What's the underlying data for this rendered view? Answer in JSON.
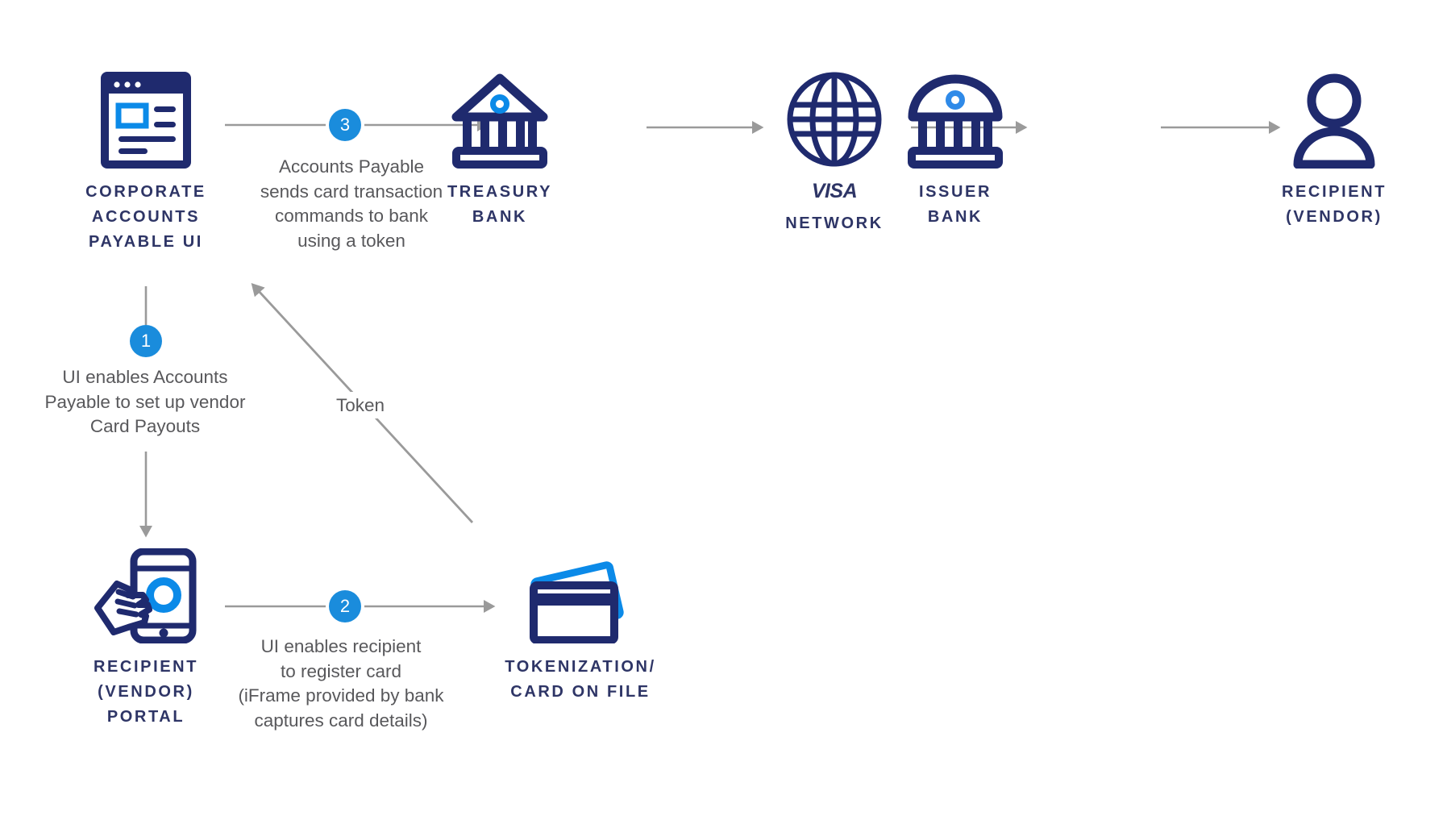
{
  "diagram": {
    "title_colors": {
      "navy": "#2e3566",
      "deep_navy": "#1f2a6e",
      "bright_blue": "#1a8cdc",
      "accent_blue": "#0b7ae0",
      "gray_text": "#58585b",
      "gray_arrow": "#9a9a9a",
      "background": "#ffffff"
    },
    "nodes": [
      {
        "id": "corporate-ap-ui",
        "icon": "browser-window-icon",
        "label": "CORPORATE\nACCOUNTS\nPAYABLE UI"
      },
      {
        "id": "treasury-bank",
        "icon": "bank-triangular-roof-icon",
        "label": "TREASURY\nBANK"
      },
      {
        "id": "visa-network",
        "icon": "globe-icon",
        "label": "NETWORK",
        "wordmark": "VISA"
      },
      {
        "id": "issuer-bank",
        "icon": "bank-dome-roof-icon",
        "label": "ISSUER\nBANK"
      },
      {
        "id": "recipient-vendor",
        "icon": "person-icon",
        "label": "RECIPIENT\n(VENDOR)"
      },
      {
        "id": "recipient-vendor-portal",
        "icon": "mobile-tap-icon",
        "label": "RECIPIENT\n(VENDOR)\nPORTAL"
      },
      {
        "id": "tokenization-card-on-file",
        "icon": "credit-cards-icon",
        "label": "TOKENIZATION/\nCARD ON FILE"
      }
    ],
    "steps": [
      {
        "number": "1",
        "text": "UI enables Accounts\nPayable to set up vendor\nCard Payouts"
      },
      {
        "number": "2",
        "text": "UI enables recipient\nto register card\n(iFrame provided by bank\ncaptures card details)"
      },
      {
        "number": "3",
        "text": "Accounts Payable\nsends card transaction\ncommands to bank\nusing a token"
      }
    ],
    "connector_labels": [
      {
        "id": "token-flow",
        "text": "Token"
      }
    ]
  }
}
